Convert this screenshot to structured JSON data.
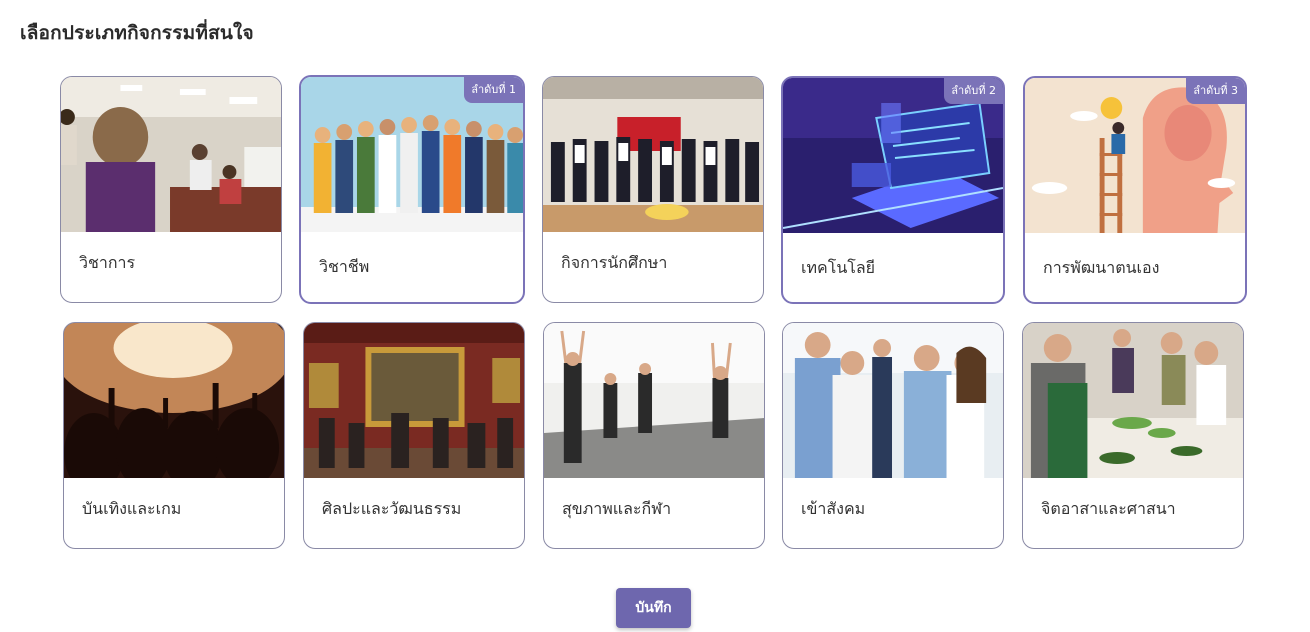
{
  "page": {
    "title": "เลือกประเภทกิจกรรมที่สนใจ",
    "save_label": "บันทึก"
  },
  "colors": {
    "accent": "#7b73b8",
    "button": "#6e67ae",
    "card_border": "#8a8aa6"
  },
  "categories": [
    {
      "label": "วิชาการ",
      "selected": false,
      "rank": ""
    },
    {
      "label": "วิชาชีพ",
      "selected": true,
      "rank": "ลำดับที่ 1"
    },
    {
      "label": "กิจการนักศึกษา",
      "selected": false,
      "rank": ""
    },
    {
      "label": "เทคโนโลยี",
      "selected": true,
      "rank": "ลำดับที่ 2"
    },
    {
      "label": "การพัฒนาตนเอง",
      "selected": true,
      "rank": "ลำดับที่ 3"
    },
    {
      "label": "บันเทิงและเกม",
      "selected": false,
      "rank": ""
    },
    {
      "label": "ศิลปะและวัฒนธรรม",
      "selected": false,
      "rank": ""
    },
    {
      "label": "สุขภาพและกีฬา",
      "selected": false,
      "rank": ""
    },
    {
      "label": "เข้าสังคม",
      "selected": false,
      "rank": ""
    },
    {
      "label": "จิตอาสาและศาสนา",
      "selected": false,
      "rank": ""
    }
  ]
}
